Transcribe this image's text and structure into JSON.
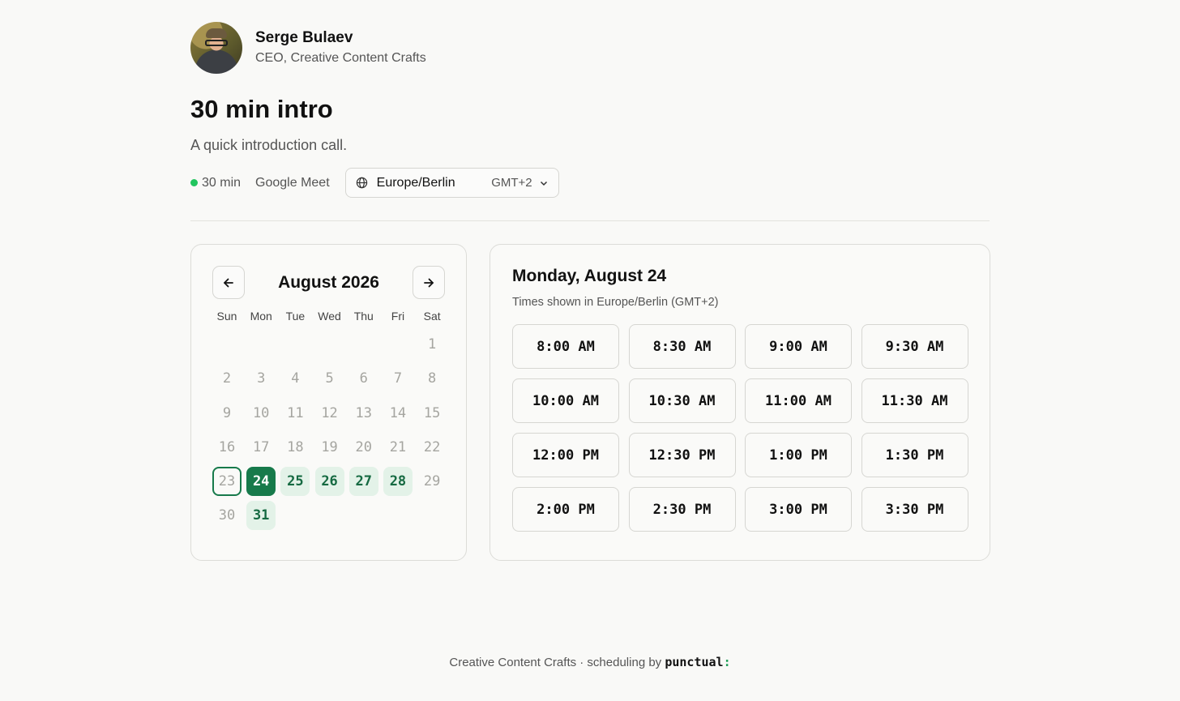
{
  "host": {
    "name": "Serge Bulaev",
    "role": "CEO, Creative Content Crafts"
  },
  "event": {
    "title": "30 min intro",
    "description": "A quick introduction call.",
    "duration": "30 min",
    "location": "Google Meet"
  },
  "timezone": {
    "name": "Europe/Berlin",
    "offset": "GMT+2"
  },
  "calendar": {
    "month_label": "August 2026",
    "weekdays": [
      "Sun",
      "Mon",
      "Tue",
      "Wed",
      "Thu",
      "Fri",
      "Sat"
    ],
    "leading_blanks": 6,
    "days": [
      {
        "d": "1",
        "s": "past"
      },
      {
        "d": "2",
        "s": "past"
      },
      {
        "d": "3",
        "s": "past"
      },
      {
        "d": "4",
        "s": "past"
      },
      {
        "d": "5",
        "s": "past"
      },
      {
        "d": "6",
        "s": "past"
      },
      {
        "d": "7",
        "s": "past"
      },
      {
        "d": "8",
        "s": "past"
      },
      {
        "d": "9",
        "s": "past"
      },
      {
        "d": "10",
        "s": "past"
      },
      {
        "d": "11",
        "s": "past"
      },
      {
        "d": "12",
        "s": "past"
      },
      {
        "d": "13",
        "s": "past"
      },
      {
        "d": "14",
        "s": "past"
      },
      {
        "d": "15",
        "s": "past"
      },
      {
        "d": "16",
        "s": "past"
      },
      {
        "d": "17",
        "s": "past"
      },
      {
        "d": "18",
        "s": "past"
      },
      {
        "d": "19",
        "s": "past"
      },
      {
        "d": "20",
        "s": "past"
      },
      {
        "d": "21",
        "s": "past"
      },
      {
        "d": "22",
        "s": "past"
      },
      {
        "d": "23",
        "s": "today"
      },
      {
        "d": "24",
        "s": "selected"
      },
      {
        "d": "25",
        "s": "avail"
      },
      {
        "d": "26",
        "s": "avail"
      },
      {
        "d": "27",
        "s": "avail"
      },
      {
        "d": "28",
        "s": "avail"
      },
      {
        "d": "29",
        "s": "past"
      },
      {
        "d": "30",
        "s": "past"
      },
      {
        "d": "31",
        "s": "avail"
      }
    ]
  },
  "slots": {
    "date_label": "Monday, August 24",
    "tz_note": "Times shown in Europe/Berlin (GMT+2)",
    "times": [
      "8:00 AM",
      "8:30 AM",
      "9:00 AM",
      "9:30 AM",
      "10:00 AM",
      "10:30 AM",
      "11:00 AM",
      "11:30 AM",
      "12:00 PM",
      "12:30 PM",
      "1:00 PM",
      "1:30 PM",
      "2:00 PM",
      "2:30 PM",
      "3:00 PM",
      "3:30 PM"
    ]
  },
  "footer": {
    "company": "Creative Content Crafts · scheduling by ",
    "brand": "punctual",
    "brand_suffix": ":"
  },
  "colors": {
    "accent": "#177a4b",
    "available_bg": "#e3f2e8",
    "status_dot": "#22c55e"
  },
  "icons": {
    "prev": "arrow-left-icon",
    "next": "arrow-right-icon",
    "timezone": "globe-icon",
    "dropdown": "chevron-down-icon"
  }
}
